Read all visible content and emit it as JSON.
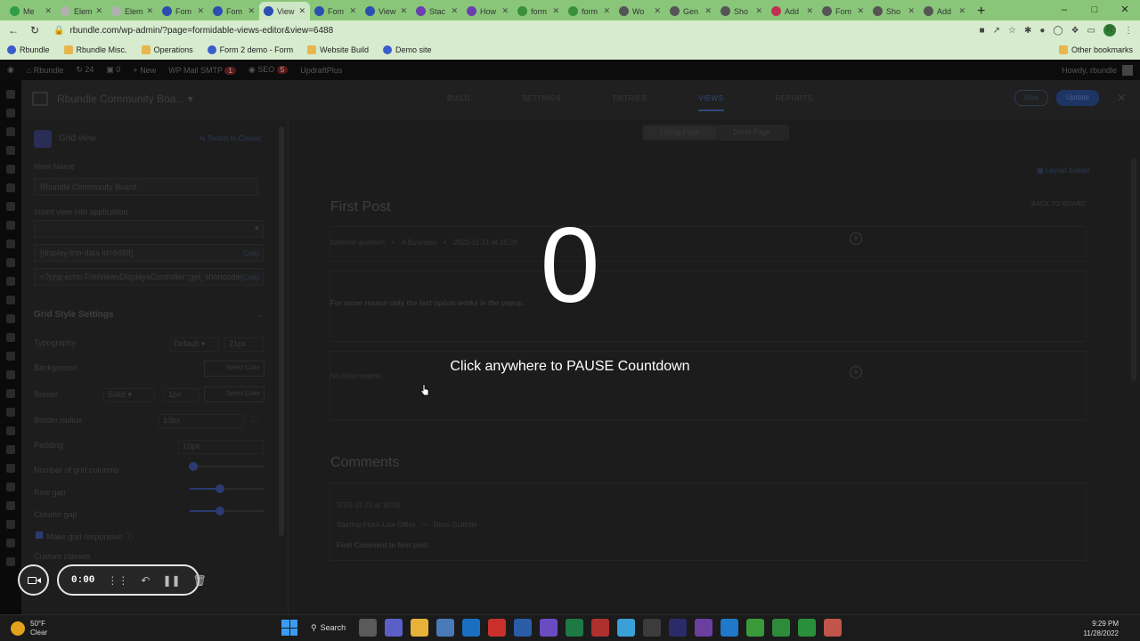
{
  "browser": {
    "tabs": [
      {
        "label": "Me",
        "color": "#2f9d4a"
      },
      {
        "label": "Elem",
        "color": "#b0b0b0"
      },
      {
        "label": "Elem",
        "color": "#b0b0b0"
      },
      {
        "label": "Fom",
        "color": "#2a4fb0"
      },
      {
        "label": "Fom",
        "color": "#2a4fb0"
      },
      {
        "label": "View",
        "color": "#2a4fb0",
        "active": true
      },
      {
        "label": "Fom",
        "color": "#2a4fb0"
      },
      {
        "label": "View",
        "color": "#2a4fb0"
      },
      {
        "label": "Stac",
        "color": "#6b3fb0"
      },
      {
        "label": "How",
        "color": "#6b3fb0"
      },
      {
        "label": "form",
        "color": "#3a8f3a"
      },
      {
        "label": "form",
        "color": "#3a8f3a"
      },
      {
        "label": "Wo",
        "color": "#555555"
      },
      {
        "label": "Gen",
        "color": "#555555"
      },
      {
        "label": "Sho",
        "color": "#555555"
      },
      {
        "label": "Add",
        "color": "#c03050"
      },
      {
        "label": "Fom",
        "color": "#555555"
      },
      {
        "label": "Sho",
        "color": "#555555"
      },
      {
        "label": "Add",
        "color": "#555555"
      }
    ],
    "url": "rbundle.com/wp-admin/?page=formidable-views-editor&view=6488",
    "bookmarks": [
      "Rbundle",
      "Rbundle Misc.",
      "Operations",
      "Form 2 demo - Form",
      "Website Build",
      "Demo site"
    ],
    "other_bookmarks": "Other bookmarks",
    "profile_initial": "R"
  },
  "wpbar": {
    "site": "Rbundle",
    "updates": "24",
    "comments": "0",
    "new": "New",
    "smtp": "WP Mail SMTP",
    "smtp_badge": "1",
    "seo": "SEO",
    "seo_badge": "5",
    "updraft": "UpdraftPlus",
    "howdy": "Howdy, rbundle"
  },
  "editor": {
    "view_title": "Rbundle Community Boa...",
    "tabs": [
      "BUILD",
      "SETTINGS",
      "ENTRIES",
      "VIEWS",
      "REPORTS"
    ],
    "active_tab": "VIEWS",
    "view_button": "View",
    "update_button": "Update"
  },
  "left_panel": {
    "mode": "Grid view",
    "switch_link": "Switch to Classic",
    "view_name_label": "View Name",
    "view_name_value": "Rbundle Community Board",
    "insert_label": "Insert view into application",
    "shortcode": "[display-frm-data id=6488]",
    "php_code": "<?php echo FrmViewsDisplaysController::get_shortcode(",
    "copy_label": "Copy",
    "section_title": "Grid Style Settings",
    "typography_label": "Typography",
    "typography_value": "Default",
    "typography_size": "21px",
    "background_label": "Background",
    "select_color": "Select Color",
    "border_label": "Border",
    "border_style": "Solid",
    "border_width": "1px",
    "border_radius_label": "Border radius",
    "border_radius_value": "10px",
    "padding_label": "Padding",
    "padding_value": "10px",
    "grid_columns_label": "Number of grid columns",
    "grid_columns_level": 0.05,
    "row_gap_label": "Row gap",
    "row_gap_level": 0.4,
    "column_gap_label": "Column gap",
    "column_gap_level": 0.4,
    "responsive_label": "Make grid responsive",
    "custom_classes_label": "Custom classes"
  },
  "content": {
    "seg_listing": "Listing Page",
    "seg_detail": "Detail Page",
    "layout_builder": "Layout builder",
    "back_to_board": "BACK TO BOARD",
    "post_title": "First Post",
    "meta_category": "General question",
    "meta_business": "A Business",
    "meta_date": "2022-11-21 at 16:28",
    "body_text": "For some reason only the text option works in the popup.",
    "no_attachments": "No Attachments",
    "comments_title": "Comments",
    "comment_date": "2022-11-22 at 10:00",
    "comment_company": "Starling-Flock Law Office",
    "comment_author": "Russ Guilfoile",
    "comment_text": "First Comment to first post"
  },
  "overlay": {
    "countdown": "0",
    "message": "Click anywhere to PAUSE Countdown"
  },
  "recorder": {
    "time": "0:00"
  },
  "taskbar": {
    "temp": "50°F",
    "condition": "Clear",
    "search": "Search",
    "time": "9:29 PM",
    "date": "11/28/2022"
  }
}
